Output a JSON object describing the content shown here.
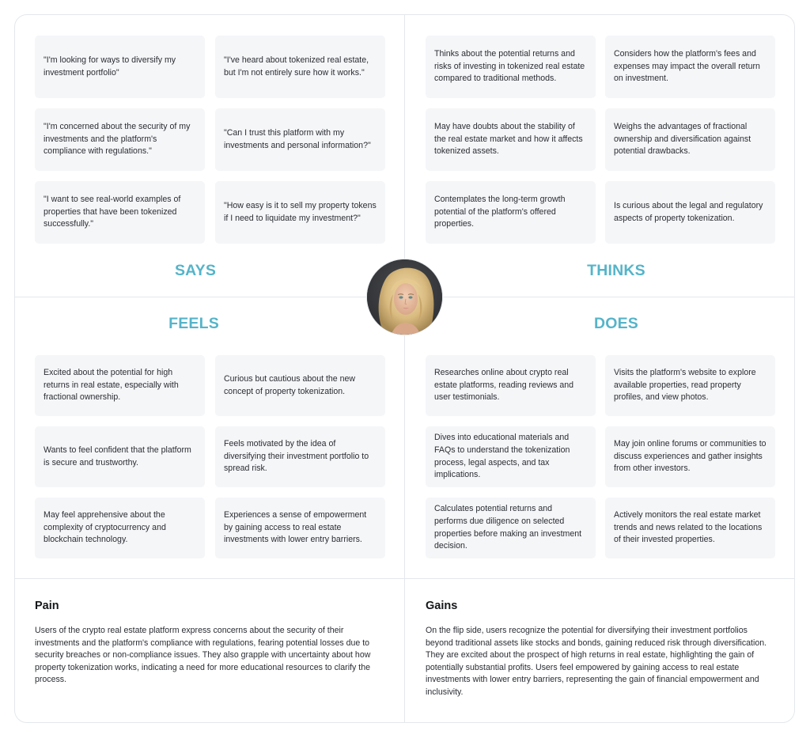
{
  "quadrants": {
    "says": {
      "title": "SAYS",
      "items": [
        "\"I'm looking for ways to diversify my investment portfolio\"",
        "\"I've heard about tokenized real estate, but I'm not entirely sure how it works.\"",
        "\"I'm concerned about the security of my investments and the platform's compliance with regulations.\"",
        "\"Can I trust this platform with my investments and personal information?\"",
        "\"I want to see real-world examples of properties that have been tokenized successfully.\"",
        "\"How easy is it to sell my property tokens if I need to liquidate my investment?\""
      ]
    },
    "thinks": {
      "title": "THINKS",
      "items": [
        "Thinks about the potential returns and risks of investing in tokenized real estate compared to traditional methods.",
        "Considers how the platform's fees and expenses may impact the overall return on investment.",
        "May have doubts about the stability of the real estate market and how it affects tokenized assets.",
        "Weighs the advantages of fractional ownership and diversification against potential drawbacks.",
        "Contemplates the long-term growth potential of the platform's offered properties.",
        "Is curious about the legal and regulatory aspects of property tokenization."
      ]
    },
    "feels": {
      "title": "FEELS",
      "items": [
        "Excited about the potential for high returns in real estate, especially with fractional ownership.",
        "Curious but cautious about the new concept of property tokenization.",
        "Wants to feel confident that the platform is secure and trustworthy.",
        "Feels motivated by the idea of diversifying their investment portfolio to spread risk.",
        "May feel apprehensive about the complexity of cryptocurrency and blockchain technology.",
        "Experiences a sense of empowerment by gaining access to real estate investments with lower entry barriers."
      ]
    },
    "does": {
      "title": "DOES",
      "items": [
        "Researches online about crypto real estate platforms, reading reviews and user testimonials.",
        "Visits the platform's website to explore available properties, read property profiles, and view photos.",
        "Dives into educational materials and FAQs to understand the tokenization process, legal aspects, and tax implications.",
        "May join online forums or communities to discuss experiences and gather insights from other investors.",
        "Calculates potential returns and performs due diligence on selected properties before making an investment decision.",
        "Actively monitors the real estate market trends and news related to the locations of their invested properties."
      ]
    }
  },
  "persona": {
    "avatar_alt": "Persona portrait: woman with wavy blonde hair"
  },
  "pain": {
    "title": "Pain",
    "text": "Users of the crypto real estate platform express concerns about the security of their investments and the platform's compliance with regulations, fearing potential losses due to security breaches or non-compliance issues. They also grapple with uncertainty about how property tokenization works, indicating a need for more educational resources to clarify the process."
  },
  "gains": {
    "title": "Gains",
    "text": "On the flip side, users recognize the potential for diversifying their investment portfolios beyond traditional assets like stocks and bonds, gaining reduced risk through diversification. They are excited about the prospect of high returns in real estate, highlighting the gain of potentially substantial profits. Users feel empowered by gaining access to real estate investments with lower entry barriers, representing the gain of financial empowerment and inclusivity."
  },
  "colors": {
    "accent": "#55b4c9",
    "card_bg": "#f5f6f8",
    "divider": "#e4e8ec"
  }
}
